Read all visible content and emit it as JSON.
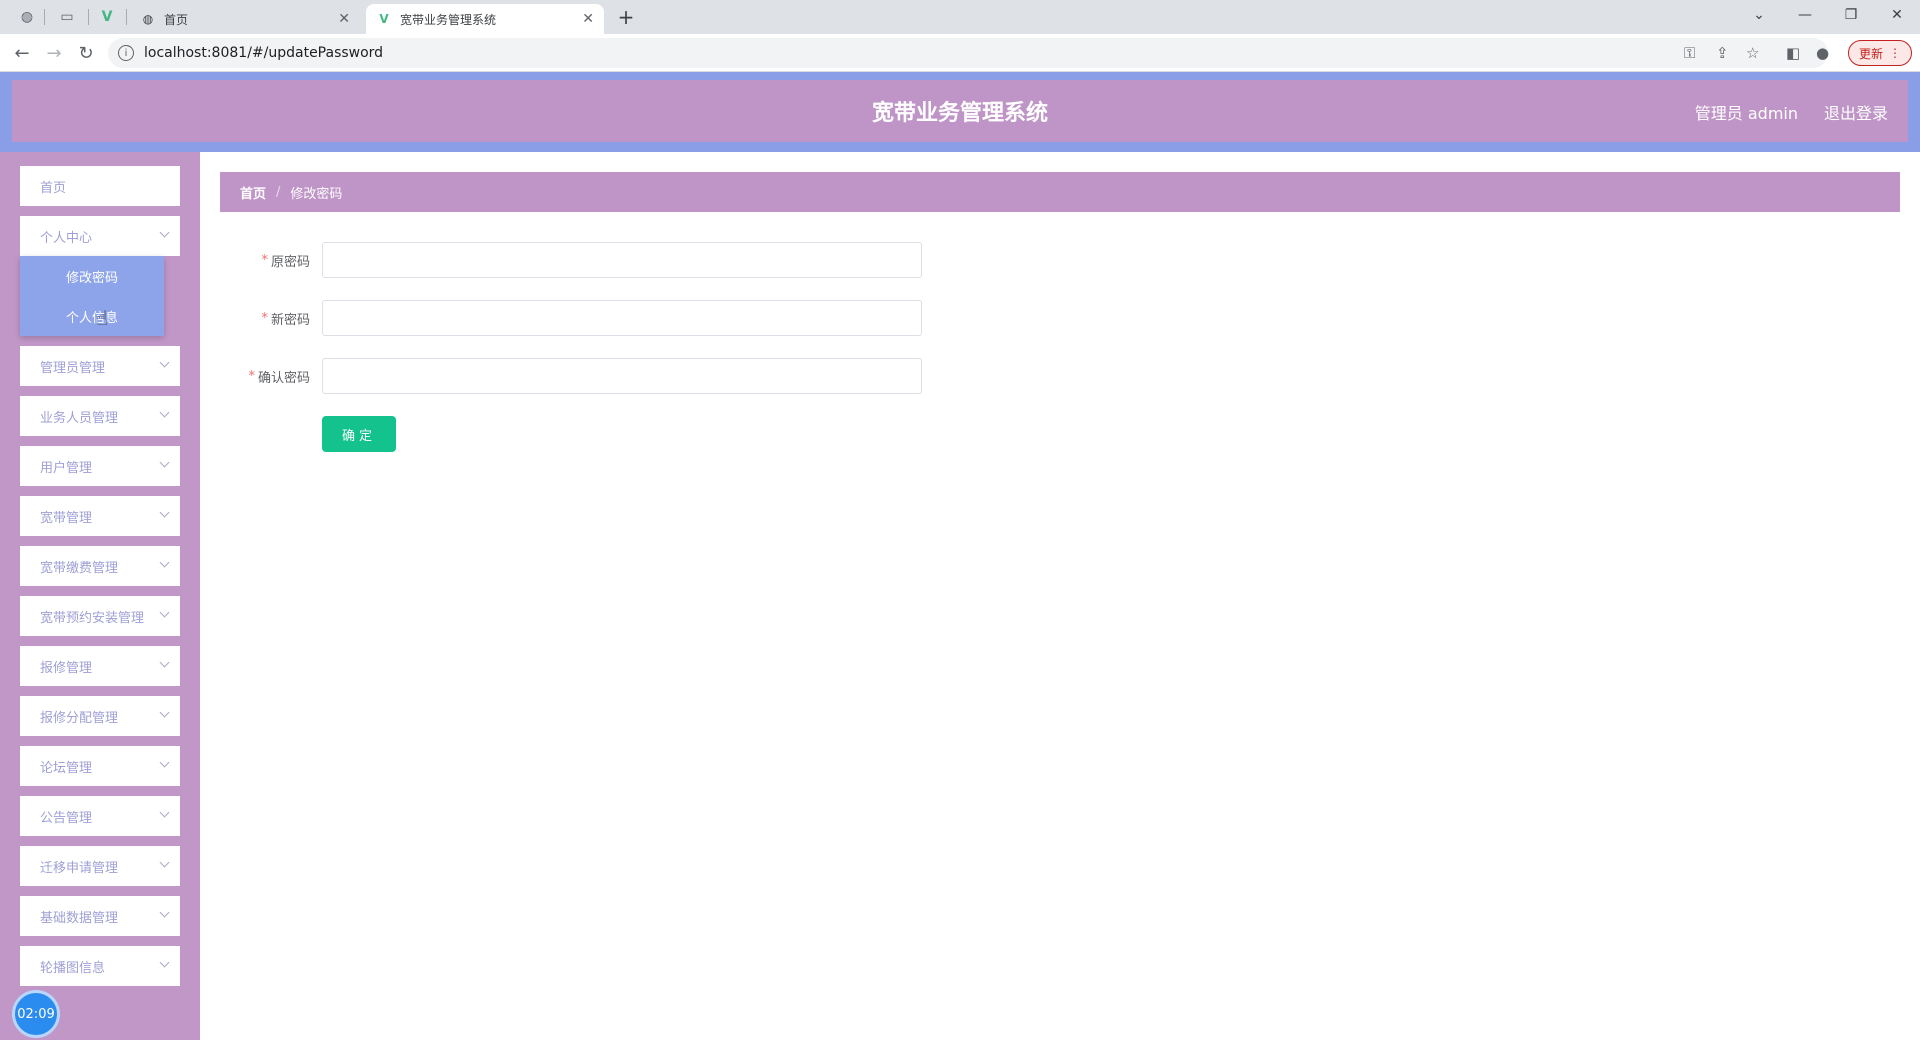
{
  "browser": {
    "tabs": [
      {
        "title": "首页",
        "favicon": "globe-icon"
      },
      {
        "title": "宽带业务管理系统",
        "favicon": "vue-icon"
      }
    ],
    "url": "localhost:8081/#/updatePassword",
    "update_label": "更新"
  },
  "header": {
    "title": "宽带业务管理系统",
    "user": "管理员 admin",
    "logout": "退出登录"
  },
  "sidebar": {
    "items": [
      {
        "label": "首页"
      },
      {
        "label": "个人中心"
      },
      {
        "label": "管理员管理"
      },
      {
        "label": "业务人员管理"
      },
      {
        "label": "用户管理"
      },
      {
        "label": "宽带管理"
      },
      {
        "label": "宽带缴费管理"
      },
      {
        "label": "宽带预约安装管理"
      },
      {
        "label": "报修管理"
      },
      {
        "label": "报修分配管理"
      },
      {
        "label": "论坛管理"
      },
      {
        "label": "公告管理"
      },
      {
        "label": "迁移申请管理"
      },
      {
        "label": "基础数据管理"
      },
      {
        "label": "轮播图信息"
      }
    ],
    "submenu": [
      {
        "label": "修改密码"
      },
      {
        "label": "个人信息"
      }
    ]
  },
  "clock": "02:09",
  "breadcrumb": {
    "home": "首页",
    "sep": "/",
    "current": "修改密码"
  },
  "form": {
    "required_mark": "*",
    "fields": [
      {
        "label": "原密码",
        "value": ""
      },
      {
        "label": "新密码",
        "value": ""
      },
      {
        "label": "确认密码",
        "value": ""
      }
    ],
    "submit": "确定"
  }
}
